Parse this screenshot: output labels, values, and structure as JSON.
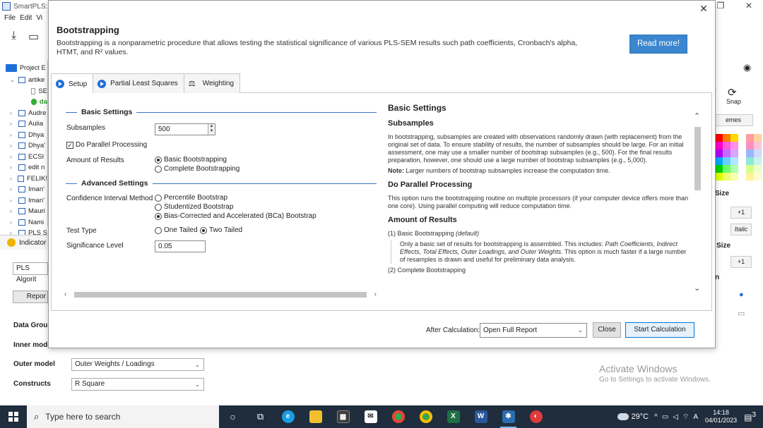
{
  "background_app": {
    "title": "SmartPLS: C",
    "menu": [
      "File",
      "Edit",
      "Vi"
    ],
    "project_label": "Project E",
    "tree_items": [
      "artike",
      "SE",
      "da",
      "Audre",
      "Aulia",
      "Dhya",
      "Dhya'",
      "ECSI",
      "edit n",
      "FELIK!",
      "Iman'",
      "Iman'",
      "Mauri",
      "Nami",
      "PLS S"
    ],
    "indicator_label": "Indicator",
    "pls_algorithm_field": "PLS Algorit",
    "report_button": "Repor",
    "data_groups_label": "Data Group",
    "inner_model_label": "Inner mode",
    "outer_model_label": "Outer model",
    "outer_model_value": "Outer Weights / Loadings",
    "constructs_label": "Constructs",
    "constructs_value": "R Square",
    "right_panel": {
      "snap": "Snap",
      "themes": "emes",
      "size1": "Size",
      "plus1": "+1",
      "italic": "Italic",
      "size2": "Size",
      "plus2": "+1",
      "n_label": "n"
    },
    "watermark_line1": "Activate Windows",
    "watermark_line2": "Go to Settings to activate Windows."
  },
  "dialog": {
    "title": "Bootstrapping",
    "description": "Bootstrapping is a nonparametric procedure that allows testing the statistical significance of various PLS-SEM results such path coefficients, Cronbach's alpha, HTMT, and R² values.",
    "read_more": "Read more!",
    "tabs": [
      "Setup",
      "Partial Least Squares",
      "Weighting"
    ],
    "basic_settings": {
      "heading": "Basic Settings",
      "subsamples_label": "Subsamples",
      "subsamples_value": "500",
      "parallel_label": "Do Parallel Processing",
      "amount_label": "Amount of Results",
      "amount_options": [
        "Basic Bootstrapping",
        "Complete Bootstrapping"
      ]
    },
    "advanced_settings": {
      "heading": "Advanced Settings",
      "ci_label": "Confidence Interval Method",
      "ci_options": [
        "Percentile Bootstrap",
        "Studentized Bootstrap",
        "Bias-Corrected and Accelerated (BCa) Bootstrap"
      ],
      "test_type_label": "Test Type",
      "test_type_options": [
        "One Tailed",
        "Two Tailed"
      ],
      "significance_label": "Significance Level",
      "significance_value": "0.05"
    },
    "help": {
      "heading": "Basic Settings",
      "subsamples_heading": "Subsamples",
      "subsamples_text": "In bootstrapping, subsamples are created with observations randomly drawn (with replacement) from the original set of data. To ensure stability of results, the number of subsamples should be large. For an initial assessment, one may use a smaller number of bootstrap subsamples (e.g., 500). For the final results preparation, however, one should use a large number of bootstrap subsamples (e.g., 5,000).",
      "note_label": "Note:",
      "note_text": " Larger numbers of bootstrap subsamples increase the computation time.",
      "parallel_heading": "Do Parallel Processing",
      "parallel_text": "This option runs the bootstrapping routine on multiple processors (if your computer device offers more than one core). Using parallel computing will reduce computation time.",
      "amount_heading": "Amount of Results",
      "basic_item": "(1) Basic Bootstrapping ",
      "basic_item_default": "(default)",
      "basic_desc_1": "Only a basic set of results for bootstrapping is assembled. This includes: ",
      "basic_desc_em": "Path Coefficients, Indirect Effects, Total Effects, Outer Loadings, and Outer Weights.",
      "basic_desc_2": " This option is much faster if a large number of resamples is drawn and useful for preliminary data analysis.",
      "complete_item": "(2) Complete Bootstrapping"
    },
    "footer": {
      "after_label": "After Calculation:",
      "after_value": "Open Full Report",
      "close": "Close",
      "start": "Start Calculation"
    }
  },
  "taskbar": {
    "search_placeholder": "Type here to search",
    "temperature": "29°C",
    "time": "14:18",
    "date": "04/01/2023",
    "notification_count": "3"
  },
  "colors": {
    "accent_blue": "#3a86cf",
    "section_line": "#3a72c8",
    "taskbar": "#1f2d3d"
  }
}
